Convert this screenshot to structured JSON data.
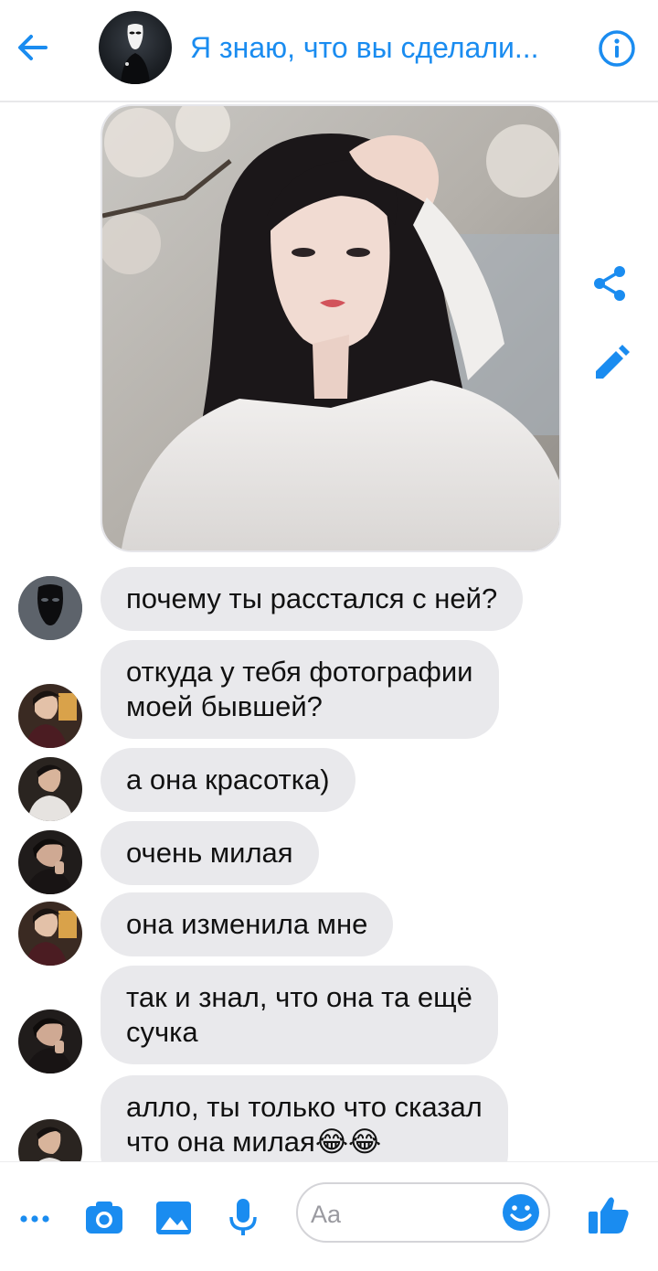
{
  "header": {
    "title": "Я знаю, что вы сделали..."
  },
  "messages": [
    {
      "text": "почему ты расстался с ней?",
      "avatar": "mask-avatar"
    },
    {
      "text": "откуда у тебя фотографии\nмоей бывшей?",
      "avatar": "user-avatar-1"
    },
    {
      "text": "а она красотка)",
      "avatar": "user-avatar-2"
    },
    {
      "text": "очень милая",
      "avatar": "user-avatar-3"
    },
    {
      "text": "она изменила мне",
      "avatar": "user-avatar-1"
    },
    {
      "text": "так и знал, что она та ещё\nсучка",
      "avatar": "user-avatar-3"
    },
    {
      "text": "алло, ты только что сказал\nчто она милая😂😂",
      "avatar": "user-avatar-2"
    }
  ],
  "composer": {
    "placeholder": "Aa"
  },
  "colors": {
    "accent": "#1a8cf0",
    "bubble": "#e9e9ec"
  },
  "icons": [
    "back-arrow-icon",
    "info-icon",
    "share-icon",
    "edit-icon",
    "more-icon",
    "camera-icon",
    "image-icon",
    "microphone-icon",
    "emoji-icon",
    "thumbs-up-icon"
  ]
}
